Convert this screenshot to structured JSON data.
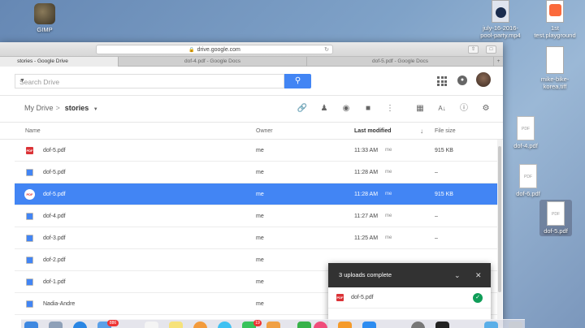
{
  "desktop": {
    "icons": [
      {
        "id": "gimp",
        "label": "GIMP"
      },
      {
        "id": "video",
        "label": "july-16-2016-pool-party.mp4"
      },
      {
        "id": "playground",
        "label": "1st test.playground"
      },
      {
        "id": "tiff",
        "label": "mike-bike-korea.tiff"
      },
      {
        "id": "dof4",
        "label": "dof-4.pdf"
      },
      {
        "id": "dof6",
        "label": "dof-6.pdf"
      },
      {
        "id": "dof5",
        "label": "dof-5.pdf"
      }
    ],
    "doc_badge": "PDF"
  },
  "browser": {
    "url": "drive.google.com",
    "tabs": [
      {
        "label": "stories - Google Drive",
        "active": true
      },
      {
        "label": "dof-4.pdf - Google Docs",
        "active": false
      },
      {
        "label": "dof-5.pdf - Google Docs",
        "active": false
      }
    ],
    "add_tab": "+"
  },
  "drive": {
    "search_placeholder": "Search Drive",
    "breadcrumb": {
      "root": "My Drive",
      "sep": ">",
      "current": "stories"
    },
    "columns": {
      "name": "Name",
      "owner": "Owner",
      "modified": "Last modified",
      "size": "File size"
    },
    "files": [
      {
        "type": "pdf",
        "name": "dof-5.pdf",
        "owner": "me",
        "modified": "11:33 AM",
        "by": "me",
        "size": "915 KB",
        "selected": false
      },
      {
        "type": "doc",
        "name": "dof-5.pdf",
        "owner": "me",
        "modified": "11:28 AM",
        "by": "me",
        "size": "–",
        "selected": false
      },
      {
        "type": "pdf",
        "name": "dof-5.pdf",
        "owner": "me",
        "modified": "11:28 AM",
        "by": "me",
        "size": "915 KB",
        "selected": true
      },
      {
        "type": "doc",
        "name": "dof-4.pdf",
        "owner": "me",
        "modified": "11:27 AM",
        "by": "me",
        "size": "–",
        "selected": false
      },
      {
        "type": "doc",
        "name": "dof-3.pdf",
        "owner": "me",
        "modified": "11:25 AM",
        "by": "me",
        "size": "–",
        "selected": false
      },
      {
        "type": "doc",
        "name": "dof-2.pdf",
        "owner": "me",
        "modified": "",
        "by": "",
        "size": "",
        "selected": false
      },
      {
        "type": "doc",
        "name": "dof-1.pdf",
        "owner": "me",
        "modified": "",
        "by": "",
        "size": "",
        "selected": false
      },
      {
        "type": "doc",
        "name": "Nadia-Andre",
        "owner": "me",
        "modified": "",
        "by": "",
        "size": "",
        "selected": false
      }
    ],
    "icon_label_pdf": "PDF"
  },
  "upload_panel": {
    "title": "3 uploads complete",
    "items": [
      {
        "name": "dof-5.pdf",
        "status": "complete"
      }
    ]
  },
  "dock": {
    "badges": [
      "886",
      "19"
    ]
  },
  "colors": {
    "accent": "#4285f4",
    "pdf": "#db3236",
    "success": "#0f9d58"
  }
}
